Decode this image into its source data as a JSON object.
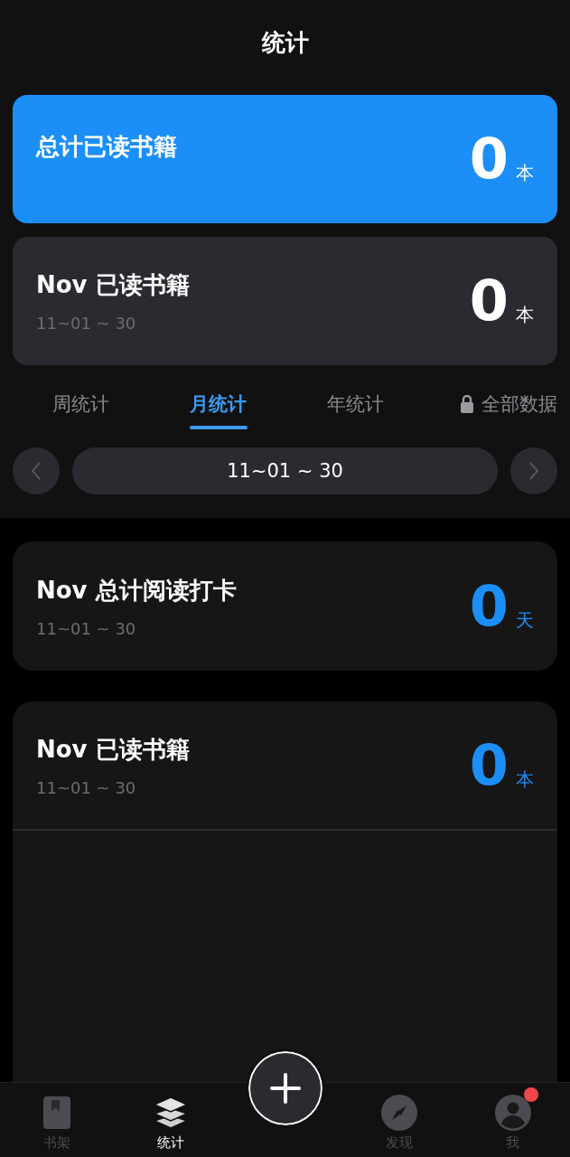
{
  "header": {
    "title": "统计"
  },
  "summary_cards": [
    {
      "kind": "primary",
      "title": "总计已读书籍",
      "value": "0",
      "unit": "本"
    },
    {
      "kind": "secondary",
      "title": "Nov 已读书籍",
      "subtitle": "11~01 ~ 30",
      "value": "0",
      "unit": "本"
    }
  ],
  "tabs": [
    {
      "label": "周统计",
      "selected": false,
      "locked": false
    },
    {
      "label": "月统计",
      "selected": true,
      "locked": false
    },
    {
      "label": "年统计",
      "selected": false,
      "locked": false
    },
    {
      "label": "全部数据",
      "selected": false,
      "locked": true
    }
  ],
  "period": {
    "label": "11~01 ~ 30"
  },
  "stat_cards": [
    {
      "title": "Nov 总计阅读打卡",
      "subtitle": "11~01 ~ 30",
      "value": "0",
      "unit": "天"
    },
    {
      "title": "Nov 已读书籍",
      "subtitle": "11~01 ~ 30",
      "value": "0",
      "unit": "本"
    }
  ],
  "nav": {
    "items": [
      {
        "kind": "tab",
        "label": "书架",
        "selected": false,
        "badge": false
      },
      {
        "kind": "tab",
        "label": "统计",
        "selected": true,
        "badge": false
      },
      {
        "kind": "add"
      },
      {
        "kind": "tab",
        "label": "发现",
        "selected": false,
        "badge": false
      },
      {
        "kind": "tab",
        "label": "我",
        "selected": false,
        "badge": true
      }
    ]
  }
}
